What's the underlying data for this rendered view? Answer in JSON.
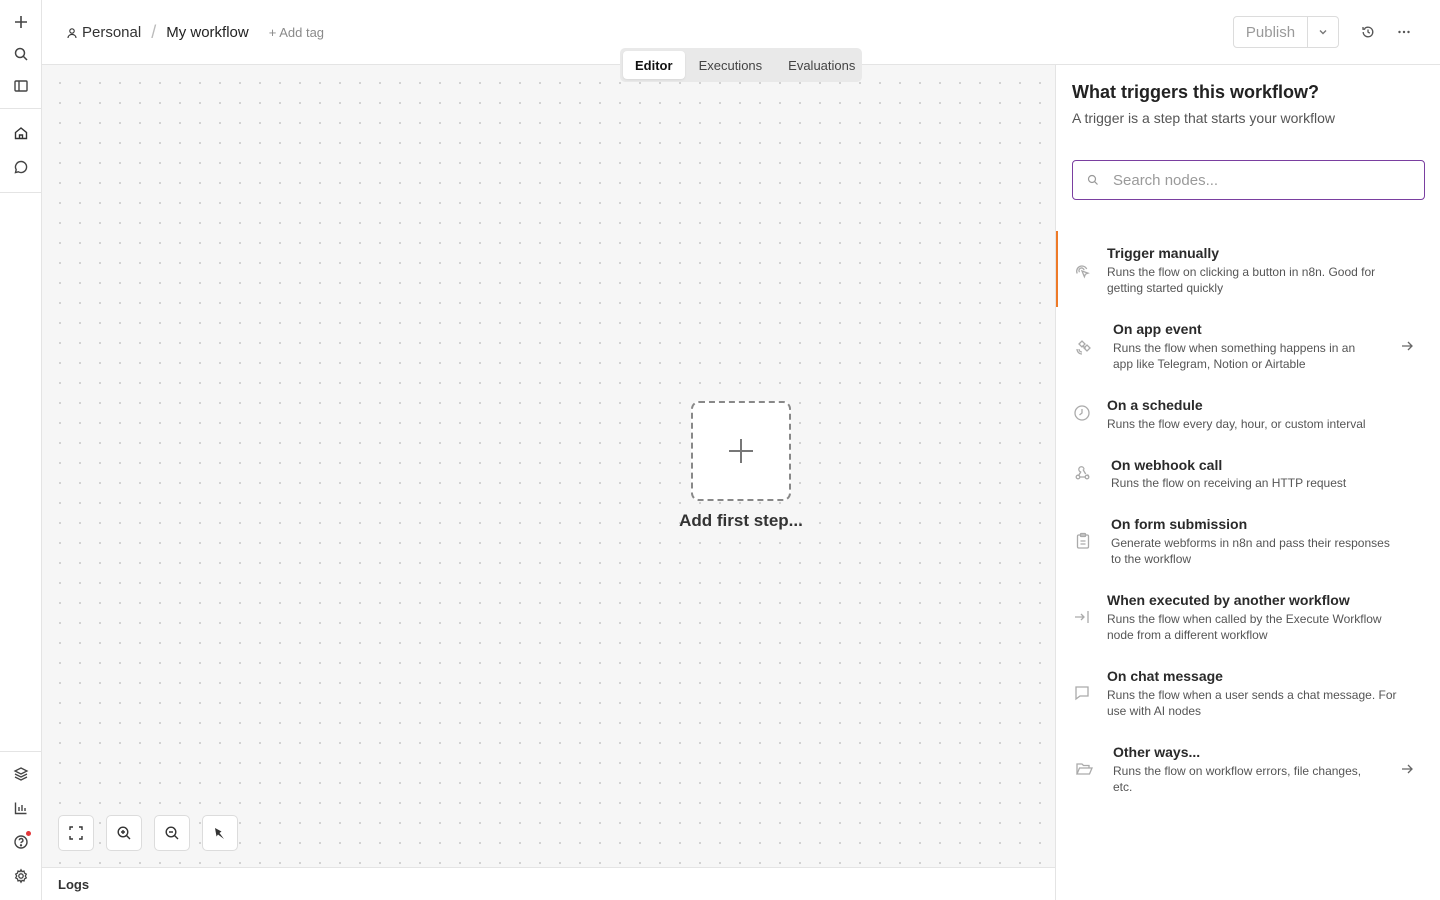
{
  "breadcrumb": {
    "project": "Personal",
    "separator": "/",
    "workflow_name": "My workflow",
    "add_tag": "+ Add tag"
  },
  "header": {
    "publish_label": "Publish"
  },
  "tabs": [
    {
      "label": "Editor",
      "active": true
    },
    {
      "label": "Executions",
      "active": false
    },
    {
      "label": "Evaluations",
      "active": false
    }
  ],
  "canvas": {
    "add_first_step": "Add first step..."
  },
  "logs": {
    "label": "Logs"
  },
  "panel": {
    "title": "What triggers this workflow?",
    "subtitle": "A trigger is a step that starts your workflow",
    "search_placeholder": "Search nodes...",
    "items": [
      {
        "title": "Trigger manually",
        "desc1": "Runs the flow on clicking a button in n8n. Good for",
        "desc2": "getting started quickly",
        "icon": "cursor-click-icon"
      },
      {
        "title": "On app event",
        "desc1": "Runs the flow when something happens in an",
        "desc2": "app like Telegram, Notion or Airtable",
        "icon": "satellite-icon"
      },
      {
        "title": "On a schedule",
        "desc1": "Runs the flow every day, hour, or custom interval",
        "desc2": "",
        "icon": "clock-icon"
      },
      {
        "title": "On webhook call",
        "desc1": "Runs the flow on receiving an HTTP request",
        "desc2": "",
        "icon": "webhook-icon"
      },
      {
        "title": "On form submission",
        "desc1": "Generate webforms in n8n and pass their responses",
        "desc2": "to the workflow",
        "icon": "clipboard-icon"
      },
      {
        "title": "When executed by another workflow",
        "desc1": "Runs the flow when called by the Execute Workflow",
        "desc2": "node from a different workflow",
        "icon": "sign-in-icon"
      },
      {
        "title": "On chat message",
        "desc1": "Runs the flow when a user sends a chat message. For",
        "desc2": "use with AI nodes",
        "icon": "chat-icon"
      },
      {
        "title": "Other ways...",
        "desc1": "Runs the flow on workflow errors, file changes,",
        "desc2": "etc.",
        "icon": "folder-open-icon"
      }
    ]
  },
  "colors": {
    "accent_selected": "#ee7a28",
    "search_border": "#7a3fa0",
    "notification_dot": "#e2363a"
  }
}
